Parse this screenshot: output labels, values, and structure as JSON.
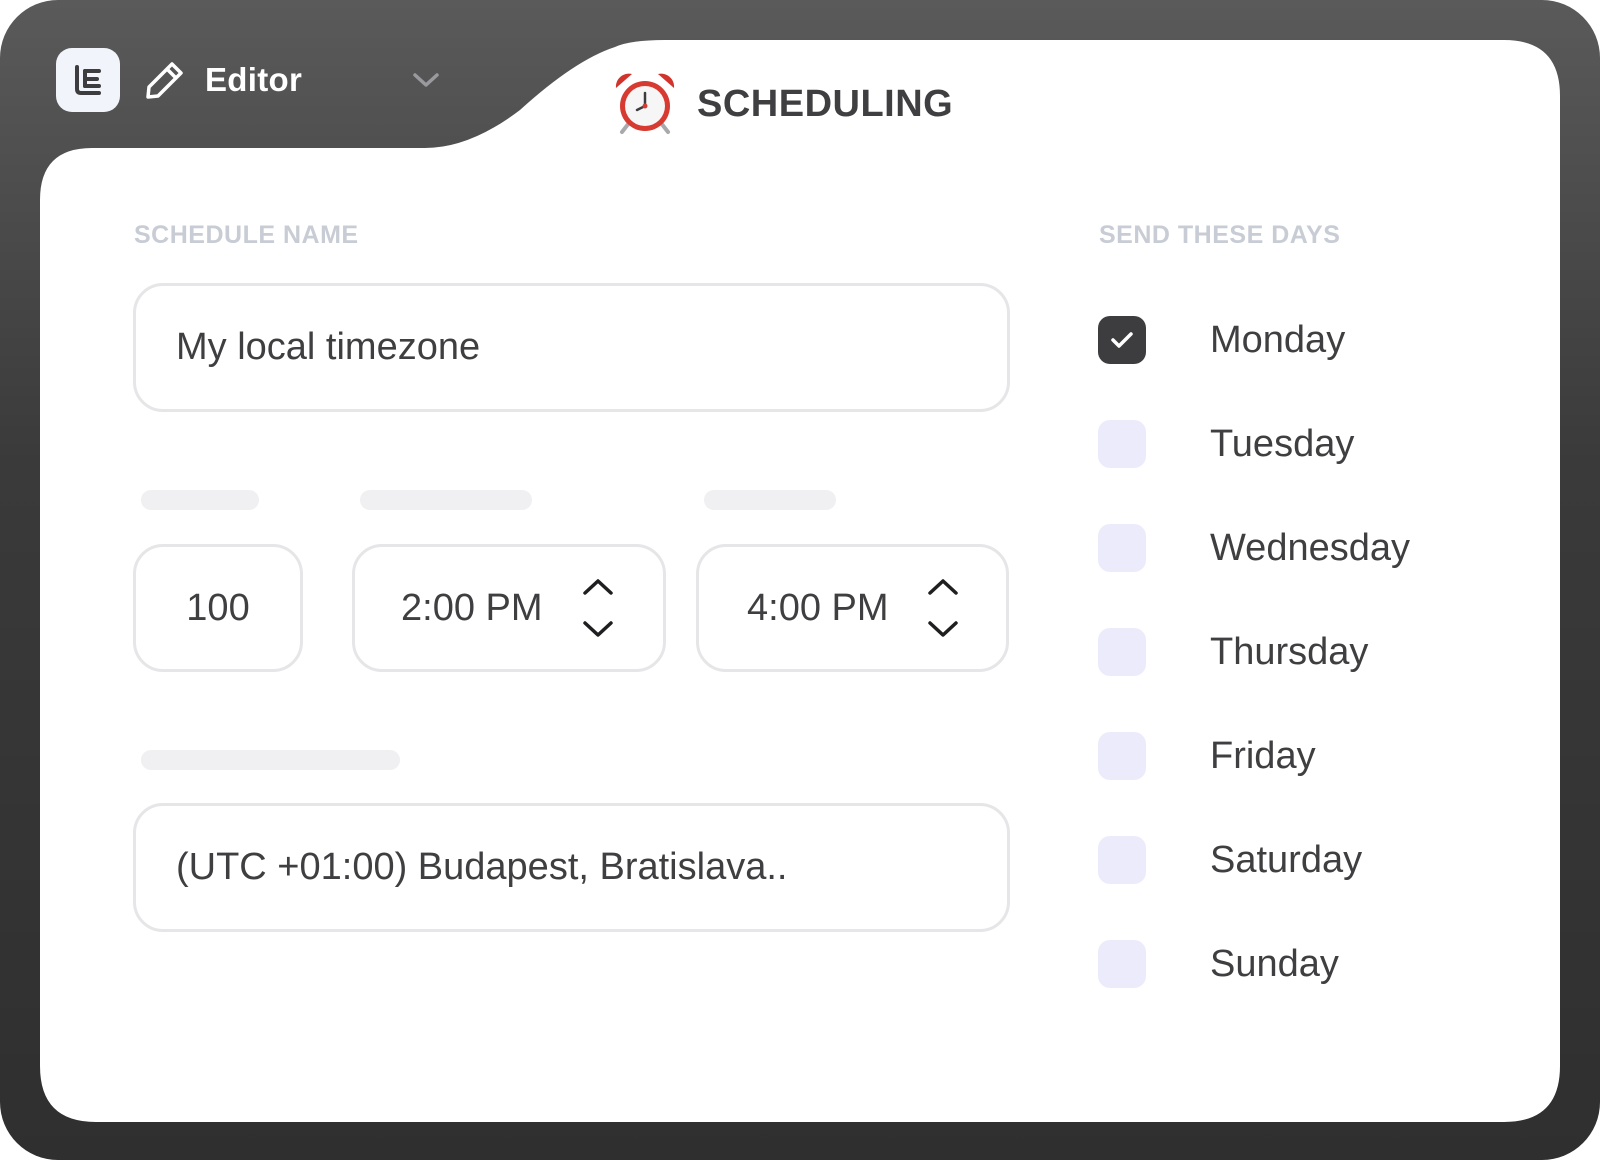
{
  "window": {
    "logo_icon": "app-logo-icon",
    "mode_icon": "pencil-icon",
    "mode_label": "Editor",
    "mode_dropdown_icon": "chevron-down-icon",
    "title_icon": "alarm-clock-icon",
    "title": "SCHEDULING"
  },
  "form": {
    "schedule_name_label": "SCHEDULE NAME",
    "schedule_name_value": "My local timezone",
    "count_value": "100",
    "start_time_value": "2:00 PM",
    "end_time_value": "4:00 PM",
    "timezone_value": "(UTC +01:00) Budapest, Bratislava.."
  },
  "days": {
    "label": "SEND THESE DAYS",
    "items": [
      {
        "label": "Monday",
        "checked": true
      },
      {
        "label": "Tuesday",
        "checked": false
      },
      {
        "label": "Wednesday",
        "checked": false
      },
      {
        "label": "Thursday",
        "checked": false
      },
      {
        "label": "Friday",
        "checked": false
      },
      {
        "label": "Saturday",
        "checked": false
      },
      {
        "label": "Sunday",
        "checked": false
      }
    ]
  },
  "colors": {
    "frame": "#3a3a3a",
    "panel": "#ffffff",
    "checked_box": "#3d3d3f",
    "unchecked_box": "#ebebfc",
    "muted_label": "#c8ccd4",
    "text": "#3f3f41"
  }
}
